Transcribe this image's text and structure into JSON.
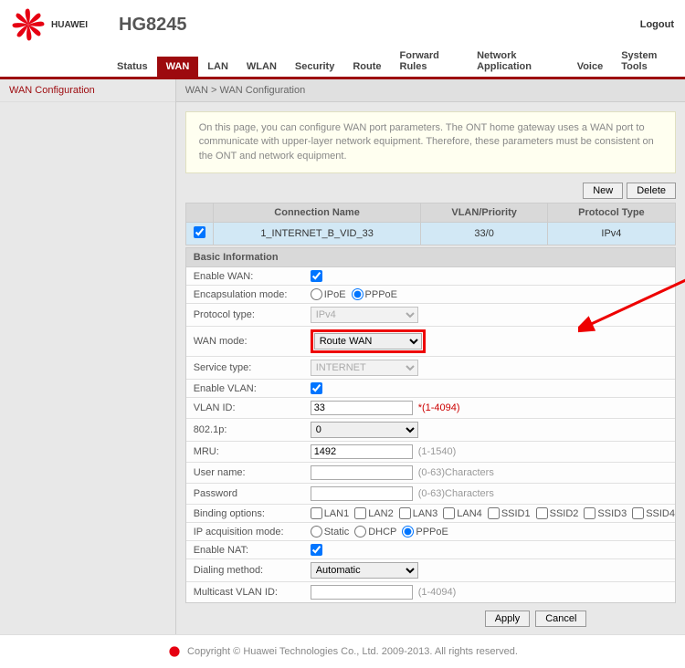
{
  "header": {
    "brand": "HUAWEI",
    "model": "HG8245",
    "logout": "Logout"
  },
  "nav": {
    "items": [
      "Status",
      "WAN",
      "LAN",
      "WLAN",
      "Security",
      "Route",
      "Forward Rules",
      "Network Application",
      "Voice",
      "System Tools"
    ],
    "active": "WAN"
  },
  "sidebar": {
    "items": [
      "WAN Configuration"
    ]
  },
  "breadcrumb": "WAN > WAN Configuration",
  "infobox": "On this page, you can configure WAN port parameters. The ONT home gateway uses a WAN port to communicate with upper-layer network equipment. Therefore, these parameters must be consistent on the ONT and network equipment.",
  "toolbar": {
    "new": "New",
    "delete": "Delete"
  },
  "table": {
    "headers": [
      "",
      "Connection Name",
      "VLAN/Priority",
      "Protocol Type"
    ],
    "rows": [
      {
        "checked": true,
        "name": "1_INTERNET_B_VID_33",
        "vlan": "33/0",
        "proto": "IPv4"
      }
    ]
  },
  "section": "Basic Information",
  "form": {
    "enable_wan": {
      "label": "Enable WAN:",
      "checked": true
    },
    "encaps": {
      "label": "Encapsulation mode:",
      "opt1": "IPoE",
      "opt2": "PPPoE",
      "selected": "PPPoE"
    },
    "proto": {
      "label": "Protocol type:",
      "value": "IPv4"
    },
    "wan_mode": {
      "label": "WAN mode:",
      "value": "Route WAN"
    },
    "service": {
      "label": "Service type:",
      "value": "INTERNET"
    },
    "enable_vlan": {
      "label": "Enable VLAN:",
      "checked": true
    },
    "vlan_id": {
      "label": "VLAN ID:",
      "value": "33",
      "hint": "*(1-4094)"
    },
    "dot1p": {
      "label": "802.1p:",
      "value": "0"
    },
    "mru": {
      "label": "MRU:",
      "value": "1492",
      "hint": "(1-1540)"
    },
    "user": {
      "label": "User name:",
      "value": "",
      "hint": "(0-63)Characters"
    },
    "pass": {
      "label": "Password",
      "value": "",
      "hint": "(0-63)Characters"
    },
    "binding": {
      "label": "Binding options:",
      "opts": [
        "LAN1",
        "LAN2",
        "LAN3",
        "LAN4",
        "SSID1",
        "SSID2",
        "SSID3",
        "SSID4"
      ]
    },
    "ip_mode": {
      "label": "IP acquisition mode:",
      "opt1": "Static",
      "opt2": "DHCP",
      "opt3": "PPPoE",
      "selected": "PPPoE"
    },
    "nat": {
      "label": "Enable NAT:",
      "checked": true
    },
    "dial": {
      "label": "Dialing method:",
      "value": "Automatic"
    },
    "mcast": {
      "label": "Multicast VLAN ID:",
      "value": "",
      "hint": "(1-4094)"
    }
  },
  "actions": {
    "apply": "Apply",
    "cancel": "Cancel"
  },
  "footer": "Copyright © Huawei Technologies Co., Ltd. 2009-2013. All rights reserved."
}
